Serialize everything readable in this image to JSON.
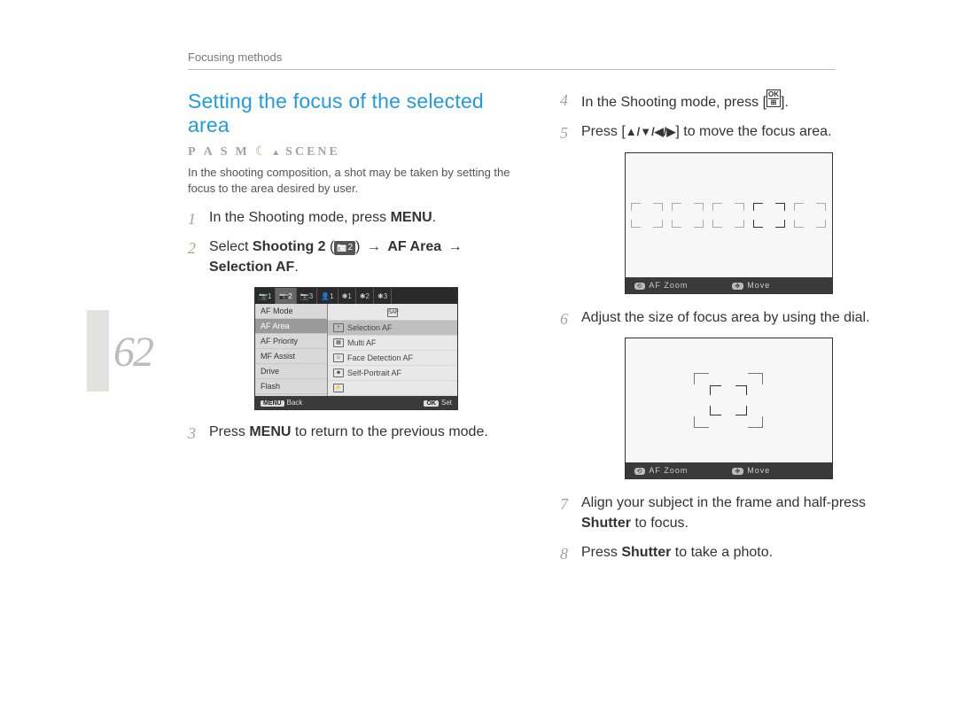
{
  "header": {
    "section": "Focusing methods"
  },
  "page_number": "62",
  "title": "Setting the focus of the selected area",
  "modes": [
    "P",
    "A",
    "S",
    "M"
  ],
  "mode_scene": "SCENE",
  "intro": "In the shooting composition, a shot may be taken by setting the focus to the area desired by user.",
  "steps_left": {
    "s1": {
      "num": "1",
      "pre": "In the Shooting mode, press ",
      "menu": "MENU",
      "post": "."
    },
    "s2": {
      "num": "2",
      "pre": "Select ",
      "shooting2": "Shooting 2",
      "cam_sub": "2",
      "arrow": "→",
      "afarea": "AF Area",
      "selectionaf": "Selection AF",
      "post": "."
    },
    "s3": {
      "num": "3",
      "pre": "Press ",
      "menu": "MENU",
      "post": " to return to the previous mode."
    }
  },
  "menu_screen": {
    "tabs": [
      "📷1",
      "📷2",
      "📷3",
      "👤1",
      "✱1",
      "✱2",
      "✱3"
    ],
    "active_tab": 1,
    "left": [
      "AF Mode",
      "AF Area",
      "AF Priority",
      "MF Assist",
      "Drive",
      "Flash"
    ],
    "left_selected": 1,
    "right_header_icon": "SAF",
    "right": [
      "Selection AF",
      "Multi AF",
      "Face Detection AF",
      "Self-Portrait AF"
    ],
    "right_selected": 0,
    "foot_back_btn": "MENU",
    "foot_back": "Back",
    "foot_set_btn": "OK",
    "foot_set": "Set"
  },
  "steps_right": {
    "s4": {
      "num": "4",
      "pre": "In the Shooting mode, press [",
      "ok": "OK",
      "post": "]."
    },
    "s5": {
      "num": "5",
      "pre": "Press [",
      "post": "] to move the focus area."
    },
    "s6": {
      "num": "6",
      "text": "Adjust the size of focus area by using the dial."
    },
    "s7": {
      "num": "7",
      "pre": "Align your subject in the frame and half-press ",
      "shutter": "Shutter",
      "post": " to focus."
    },
    "s8": {
      "num": "8",
      "pre": "Press ",
      "shutter": "Shutter",
      "post": " to take a photo."
    }
  },
  "preview_labels": {
    "zoom_icon": "⟲",
    "zoom": "AF Zoom",
    "move_icon": "✥",
    "move": "Move"
  }
}
